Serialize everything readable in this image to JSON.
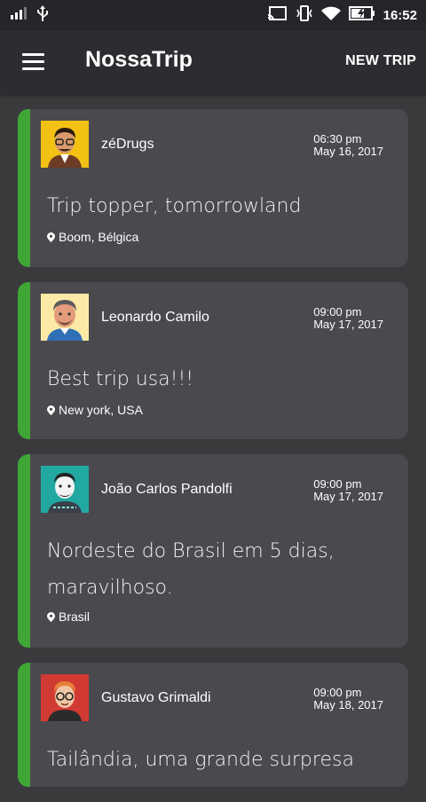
{
  "status_bar": {
    "time": "16:52"
  },
  "app_bar": {
    "title": "NossaTrip",
    "action_label": "NEW TRIP"
  },
  "trips": [
    {
      "author": "zéDrugs",
      "time": "06:30 pm",
      "date": "May 16, 2017",
      "title": "Trip topper, tomorrowland",
      "place": "Boom, Bélgica",
      "avatar_bg": "#f2c114"
    },
    {
      "author": "Leonardo Camilo",
      "time": "09:00 pm",
      "date": "May 17, 2017",
      "title": "Best trip usa!!!",
      "place": "New york, USA",
      "avatar_bg": "#fde9a6"
    },
    {
      "author": "João Carlos Pandolfi",
      "time": "09:00 pm",
      "date": "May 17, 2017",
      "title": "Nordeste do Brasil em 5 dias, maravilhoso.",
      "place": "Brasil",
      "avatar_bg": "#21a9a1"
    },
    {
      "author": "Gustavo Grimaldi",
      "time": "09:00 pm",
      "date": "May 18, 2017",
      "title": "Tailândia, uma grande surpresa",
      "place": "",
      "avatar_bg": "#d13a33"
    }
  ],
  "colors": {
    "accent": "#3fa636",
    "card": "#4a494e",
    "background": "#3a3a3c",
    "app_bar": "#2d2d31"
  }
}
